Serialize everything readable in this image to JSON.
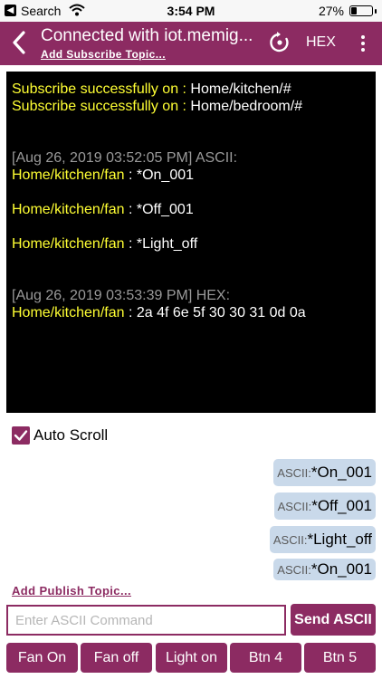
{
  "status_bar": {
    "back_app": "Search",
    "time": "3:54 PM",
    "battery_percent": "27%",
    "battery_level": 0.27
  },
  "nav": {
    "title": "Connected with iot.memig...",
    "subtitle": "Add Subscribe Topic...",
    "hex_label": "HEX",
    "accent_color": "#8c2b62"
  },
  "console": {
    "subscriptions": [
      {
        "prefix": "Subscribe successfully on : ",
        "topic": "Home/kitchen/#"
      },
      {
        "prefix": "Subscribe successfully on : ",
        "topic": "Home/bedroom/#"
      }
    ],
    "blocks": [
      {
        "header": "[Aug 26, 2019 03:52:05 PM] ASCII:",
        "messages": [
          {
            "topic": "Home/kitchen/fan",
            "sep": " : ",
            "payload": "*On_001"
          },
          {
            "topic": "Home/kitchen/fan",
            "sep": " : ",
            "payload": "*Off_001"
          },
          {
            "topic": "Home/kitchen/fan",
            "sep": " : ",
            "payload": "*Light_off"
          }
        ]
      },
      {
        "header": "[Aug 26, 2019 03:53:39 PM] HEX:",
        "messages": [
          {
            "topic": "Home/kitchen/fan",
            "sep": " : ",
            "payload": "2a 4f 6e 5f 30 30 31 0d 0a"
          }
        ]
      }
    ]
  },
  "auto_scroll": {
    "label": "Auto Scroll",
    "checked": true
  },
  "sent_messages": [
    {
      "prefix": "ASCII:",
      "text": "*On_001"
    },
    {
      "prefix": "ASCII:",
      "text": "*Off_001"
    },
    {
      "prefix": "ASCII:",
      "text": "*Light_off"
    },
    {
      "prefix": "ASCII:",
      "text": "*On_001"
    }
  ],
  "publish": {
    "add_topic_label": "Add Publish Topic...",
    "input_placeholder": "Enter ASCII Command",
    "input_value": "",
    "send_label": "Send ASCII"
  },
  "quick_buttons": [
    "Fan On",
    "Fan off",
    "Light on",
    "Btn 4",
    "Btn 5"
  ]
}
